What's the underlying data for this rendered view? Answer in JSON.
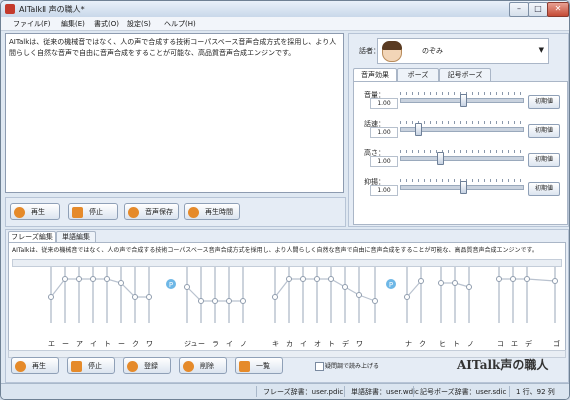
{
  "window": {
    "title": "AITalkⅡ 声の職人*"
  },
  "menu": [
    "ファイル(F)",
    "編集(E)",
    "書式(O)",
    "設定(S)",
    "ヘルプ(H)"
  ],
  "main_text": "AITalkは、従来の機械音ではなく、人の声で合成する技術コーパスベース音声合成方式を採用し、より人間らしく自然な音声で自由に音声合成をすることが可能な、高品質音声合成エンジンです。",
  "top_buttons": {
    "play": "再生",
    "stop": "停止",
    "save": "音声保存",
    "time": "再生時間"
  },
  "speaker": {
    "label": "話者：",
    "name": "のぞみ"
  },
  "tabs": [
    "音声効果",
    "ポーズ",
    "記号ポーズ"
  ],
  "params": [
    {
      "label": "音量：",
      "value": "1.00",
      "reset": "初期値",
      "level": 0.52
    },
    {
      "label": "話速：",
      "value": "1.00",
      "reset": "初期値",
      "level": 0.15
    },
    {
      "label": "高さ：",
      "value": "1.00",
      "reset": "初期値",
      "level": 0.33
    },
    {
      "label": "抑揚：",
      "value": "1.00",
      "reset": "初期値",
      "level": 0.52
    }
  ],
  "lower_tabs": [
    "フレーズ編集",
    "単語編集"
  ],
  "phrase_text": "AITalkは、従来の機械音ではなく、人の声で合成する技術コーパスベース音声合成方式を採用し、より人間らしく自然な音声で自由に音声合成をすることが可能な、高品質音声合成エンジンです。",
  "kana": [
    "エ",
    "ー",
    "ア",
    "イ",
    "ト",
    "ー",
    "ク",
    "ワ",
    "ジュ",
    "ー",
    "ラ",
    "イ",
    "ノ",
    "キ",
    "カ",
    "イ",
    "オ",
    "ト",
    "デ",
    "ワ",
    "ナ",
    "ク",
    "ヒ",
    "ト",
    "ノ",
    "コ",
    "エ",
    "デ",
    "ゴ"
  ],
  "pause_marks": [
    "P",
    "P"
  ],
  "bottom_buttons": {
    "play": "再生",
    "stop": "停止",
    "register": "登録",
    "delete": "削除",
    "list": "一覧"
  },
  "checkbox_label": "疑問調で読み上げる",
  "logo": "AITalk声の職人",
  "status": {
    "phrase_dict": "フレーズ辞書：user.pdic",
    "word_dict": "単語辞書：user.wdic",
    "symbol_dict": "記号ポーズ辞書：user.sdic",
    "position": "1 行、92 列"
  }
}
